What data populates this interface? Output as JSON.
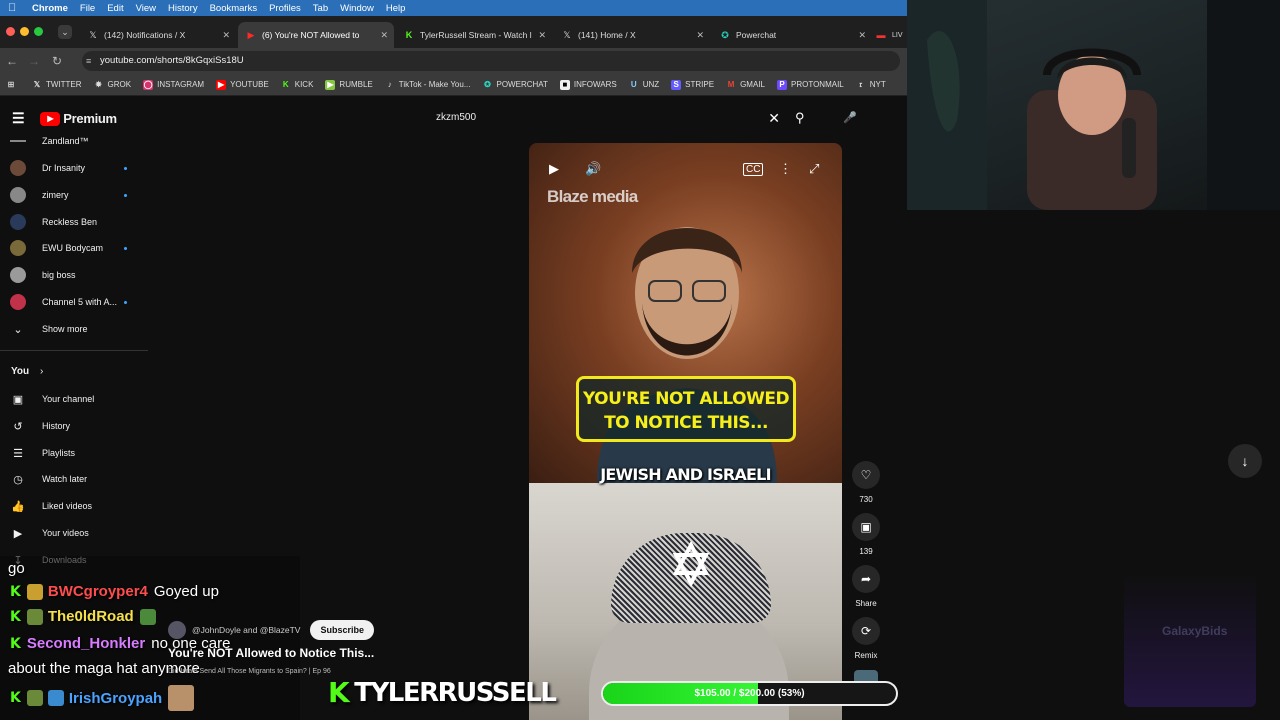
{
  "menubar": {
    "app": "Chrome",
    "items": [
      "File",
      "Edit",
      "View",
      "History",
      "Bookmarks",
      "Profiles",
      "Tab",
      "Window",
      "Help"
    ]
  },
  "tabs": [
    {
      "label": "(142) Notifications / X",
      "icon": "x-logo-icon",
      "active": false
    },
    {
      "label": "(6) You're NOT Allowed to",
      "icon": "youtube-icon",
      "active": true
    },
    {
      "label": "TylerRussell Stream - Watch l",
      "icon": "kick-icon",
      "active": false
    },
    {
      "label": "(141) Home / X",
      "icon": "x-logo-icon",
      "active": false
    },
    {
      "label": "Powerchat",
      "icon": "powerchat-icon",
      "active": false
    },
    {
      "label": "LIV",
      "icon": "live-icon",
      "active": false
    }
  ],
  "address": {
    "url": "youtube.com/shorts/8kGqxiSs18U"
  },
  "bookmarks": [
    "TWITTER",
    "GROK",
    "INSTAGRAM",
    "YOUTUBE",
    "KICK",
    "RUMBLE",
    "TikTok - Make You...",
    "POWERCHAT",
    "INFOWARS",
    "UNZ",
    "STRIPE",
    "GMAIL",
    "PROTONMAIL",
    "NYT"
  ],
  "youtube": {
    "logo_text": "Premium",
    "search_value": "zkzm500",
    "subscriptions": [
      {
        "name": "Zandland™",
        "new": false,
        "color": "#555"
      },
      {
        "name": "Dr Insanity",
        "new": true,
        "color": "#6b4a3a"
      },
      {
        "name": "zimery",
        "new": true,
        "color": "#888"
      },
      {
        "name": "Reckless Ben",
        "new": false,
        "color": "#2a3a5a"
      },
      {
        "name": "EWU Bodycam",
        "new": true,
        "color": "#7a6a3a"
      },
      {
        "name": "big boss",
        "new": false,
        "color": "#9a9a9a"
      },
      {
        "name": "Channel 5 with A...",
        "new": true,
        "color": "#c0314a"
      }
    ],
    "show_more": "Show more",
    "you_heading": "You",
    "you_items": [
      {
        "label": "Your channel",
        "icon": "account-box-icon"
      },
      {
        "label": "History",
        "icon": "history-icon"
      },
      {
        "label": "Playlists",
        "icon": "playlists-icon"
      },
      {
        "label": "Watch later",
        "icon": "clock-icon"
      },
      {
        "label": "Liked videos",
        "icon": "thumb-up-icon"
      },
      {
        "label": "Your videos",
        "icon": "video-icon"
      },
      {
        "label": "Downloads",
        "icon": "download-icon"
      }
    ],
    "short": {
      "watermark": "Blaze media",
      "caption": "YOU'RE NOT ALLOWED TO NOTICE THIS...",
      "subcaption": "JEWISH AND ISRAELI",
      "channel": "@JohnDoyle and @BlazeTV",
      "subscribe": "Subscribe",
      "title": "You're NOT Allowed to Notice This...",
      "related": "Did Israel Send All Those Migrants to Spain? | Ep 96"
    },
    "rail": [
      {
        "label": "730",
        "icon": "heart-icon"
      },
      {
        "label": "139",
        "icon": "comment-icon"
      },
      {
        "label": "Share",
        "icon": "share-icon"
      },
      {
        "label": "Remix",
        "icon": "remix-icon"
      }
    ]
  },
  "chat": {
    "messages": [
      {
        "user": "",
        "text": "go",
        "color": "#fff"
      },
      {
        "user": "BWCgroyper4",
        "text": "Goyed up",
        "color": "#ff4d4d"
      },
      {
        "user": "The0ldRoad",
        "text": "",
        "color": "#f5e14a"
      },
      {
        "user": "Second_Honkler",
        "text": "no one care",
        "color": "#d77bff"
      },
      {
        "user": "",
        "text": "about the maga hat anymore",
        "color": "#fff"
      },
      {
        "user": "IrishGroypah",
        "text": "",
        "color": "#4aa3ff"
      }
    ]
  },
  "stream": {
    "brand": "TYLERRUSSELL",
    "goal_text": "$105.00 / $200.00 (53%)",
    "goal_fraction": 0.53,
    "watermark": "GalaxyBids"
  }
}
